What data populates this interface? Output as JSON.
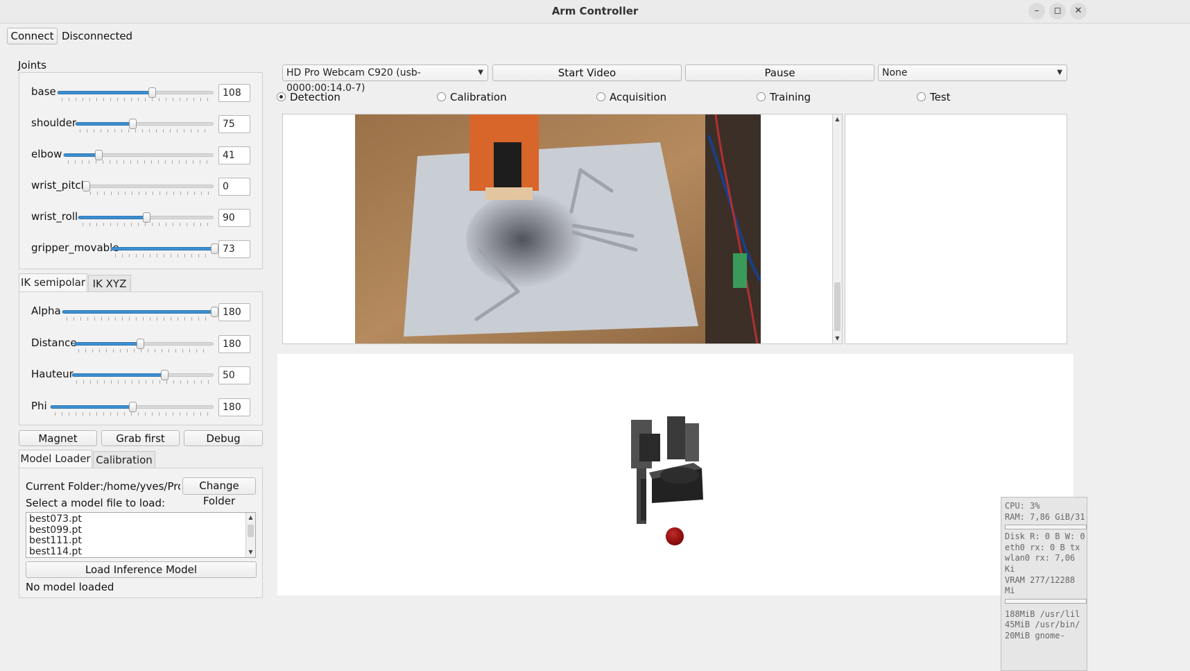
{
  "window": {
    "title": "Arm Controller"
  },
  "connection": {
    "button_label": "Connect",
    "status": "Disconnected"
  },
  "joints": {
    "title": "Joints",
    "rows": [
      {
        "label": "base",
        "value": "108",
        "level": 0.6
      },
      {
        "label": "shoulder",
        "value": "75",
        "level": 0.41
      },
      {
        "label": "elbow",
        "value": "41",
        "level": 0.23
      },
      {
        "label": "wrist_pitch",
        "value": "0",
        "level": 0.0
      },
      {
        "label": "wrist_roll",
        "value": "90",
        "level": 0.5
      },
      {
        "label": "gripper_movable",
        "value": "73",
        "level": 1.0
      }
    ]
  },
  "ik_tabs": {
    "tabs": [
      "IK semipolar",
      "IK XYZ"
    ],
    "active": 0
  },
  "ik": {
    "rows": [
      {
        "label": "Alpha",
        "value": "180",
        "level": 1.0
      },
      {
        "label": "Distance",
        "value": "180",
        "level": 0.47
      },
      {
        "label": "Hauteur",
        "value": "50",
        "level": 0.65
      },
      {
        "label": "Phi",
        "value": "180",
        "level": 0.5
      }
    ]
  },
  "actions": {
    "magnet": "Magnet",
    "grab_first": "Grab first",
    "debug": "Debug"
  },
  "model_tabs": {
    "tabs": [
      "Model Loader",
      "Calibration"
    ],
    "active": 0
  },
  "model_loader": {
    "current_folder_label": "Current Folder:",
    "current_folder_value": "/home/yves/Proje",
    "change_folder": "Change Folder",
    "select_label": "Select a model file to load:",
    "files": [
      "best073.pt",
      "best099.pt",
      "best111.pt",
      "best114.pt"
    ],
    "load_button": "Load Inference Model",
    "status": "No model loaded"
  },
  "video": {
    "camera": "HD Pro Webcam C920 (usb-0000:00:14.0-7)",
    "start": "Start Video",
    "pause": "Pause",
    "model_select": "None"
  },
  "modes": {
    "options": [
      "Detection",
      "Calibration",
      "Acquisition",
      "Training",
      "Test"
    ],
    "selected": 0
  },
  "overlay": {
    "lines": [
      "CPU: 3%",
      "RAM: 7,86 GiB/31",
      "Disk R: 0 B W: 0",
      "eth0 rx: 0 B  tx",
      "wlan0 rx: 7,06 Ki",
      "VRAM 277/12288 Mi",
      "188MiB  /usr/lil",
      "45MiB  /usr/bin/",
      "20MiB  gnome-"
    ]
  },
  "colors": {
    "accent": "#3d8fd1",
    "ball": "#8b0d0d"
  }
}
